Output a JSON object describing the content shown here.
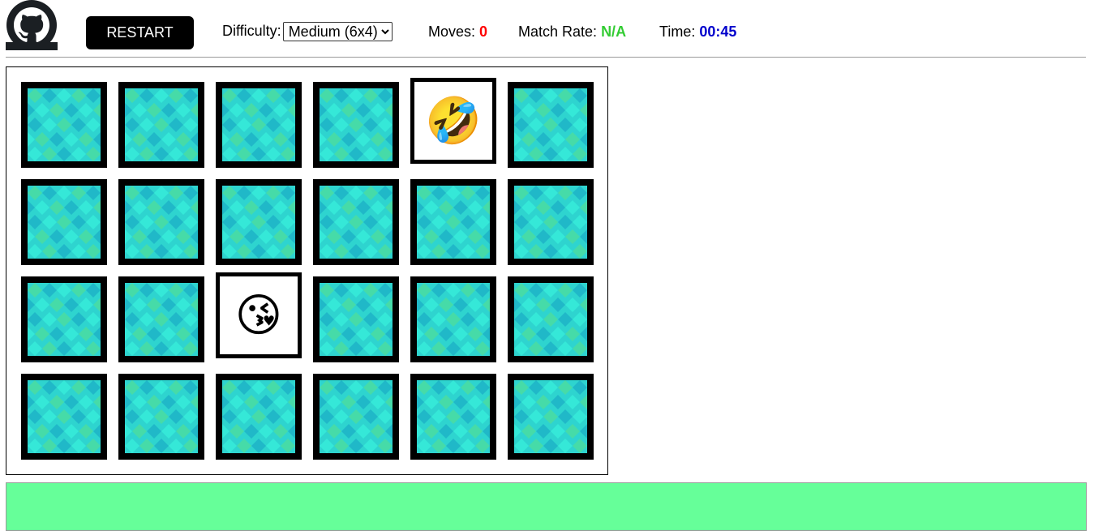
{
  "header": {
    "logo_icon": "github-icon",
    "restart_label": "RESTART",
    "difficulty_label": "Difficulty:",
    "difficulty_selected": "Medium (6x4)",
    "moves_label": "Moves:",
    "moves_value": "0",
    "match_rate_label": "Match Rate:",
    "match_rate_value": "N/A",
    "time_label": "Time:",
    "time_value": "00:45"
  },
  "colors": {
    "moves_value": "#ff0000",
    "match_rate_value": "#33cc33",
    "time_value": "#0000cc",
    "status_bar": "#66ff99",
    "card_back": "#2ed4cf"
  },
  "board": {
    "columns": 6,
    "rows": 4,
    "cards": [
      {
        "state": "face-down"
      },
      {
        "state": "face-down"
      },
      {
        "state": "face-down"
      },
      {
        "state": "face-down"
      },
      {
        "state": "face-up",
        "emoji": "🤣",
        "name": "rolling-on-floor-laughing-emoji"
      },
      {
        "state": "face-down"
      },
      {
        "state": "face-down"
      },
      {
        "state": "face-down"
      },
      {
        "state": "face-down"
      },
      {
        "state": "face-down"
      },
      {
        "state": "face-down"
      },
      {
        "state": "face-down"
      },
      {
        "state": "face-down"
      },
      {
        "state": "face-down"
      },
      {
        "state": "face-up",
        "emoji": "😘",
        "name": "face-blowing-kiss-emoji"
      },
      {
        "state": "face-down"
      },
      {
        "state": "face-down"
      },
      {
        "state": "face-down"
      },
      {
        "state": "face-down"
      },
      {
        "state": "face-down"
      },
      {
        "state": "face-down"
      },
      {
        "state": "face-down"
      },
      {
        "state": "face-down"
      },
      {
        "state": "face-down"
      }
    ]
  },
  "status_bar": {
    "text": ""
  }
}
